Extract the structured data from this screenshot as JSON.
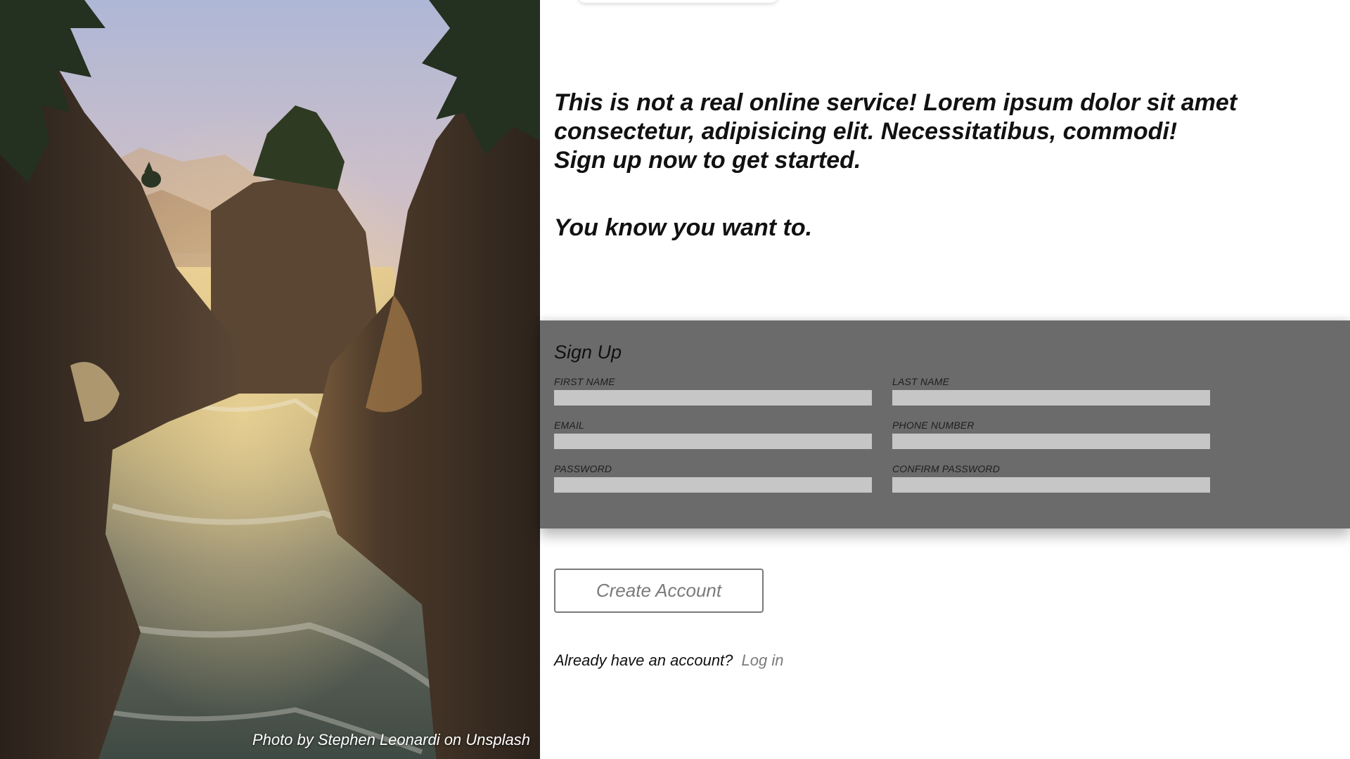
{
  "hero": {
    "credit": "Photo by Stephen Leonardi on Unsplash"
  },
  "intro": {
    "line1": "This is not a real online service! Lorem ipsum dolor sit amet",
    "line2": "consectetur, adipisicing elit. Necessitatibus, commodi!",
    "line3": "Sign up now to get started.",
    "tagline": "You know you want to."
  },
  "signup": {
    "title": "Sign Up",
    "fields": {
      "first_name": {
        "label": "FIRST NAME",
        "value": ""
      },
      "last_name": {
        "label": "LAST NAME",
        "value": ""
      },
      "email": {
        "label": "EMAIL",
        "value": ""
      },
      "phone_number": {
        "label": "PHONE NUMBER",
        "value": ""
      },
      "password": {
        "label": "PASSWORD",
        "value": ""
      },
      "confirm_password": {
        "label": "CONFIRM PASSWORD",
        "value": ""
      }
    },
    "submit_label": "Create Account"
  },
  "login": {
    "prompt": "Already have an account?",
    "link_label": "Log in"
  },
  "colors": {
    "panel_bg": "#6b6b6b",
    "input_bg": "#c6c6c6",
    "button_text": "#7a7a7a",
    "link": "#7a7a7a"
  }
}
